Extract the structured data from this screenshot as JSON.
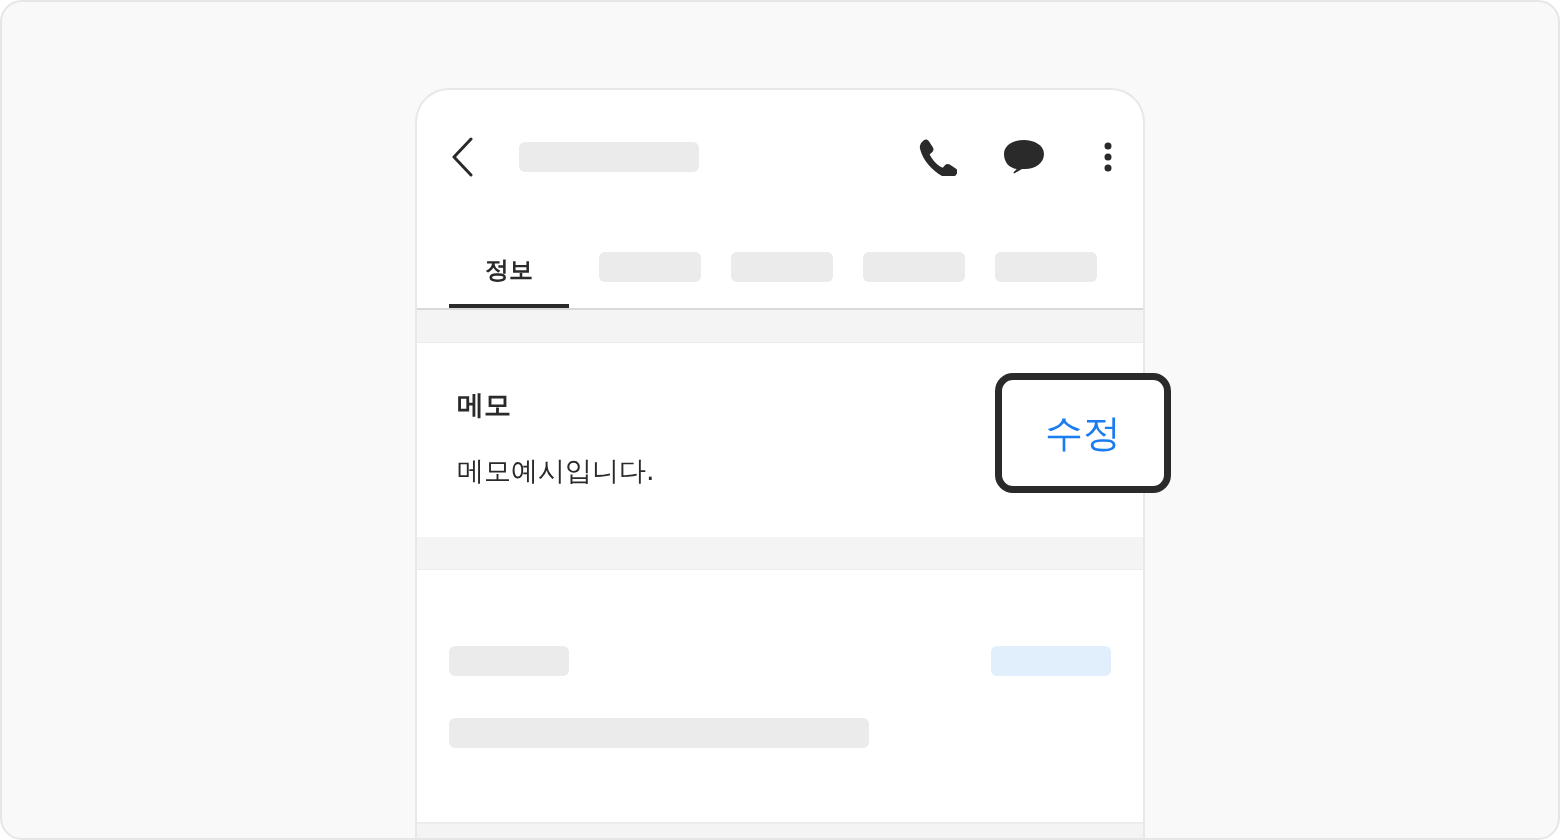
{
  "tabs": [
    {
      "label": "정보",
      "selected": true
    },
    {
      "selected": false
    },
    {
      "selected": false
    },
    {
      "selected": false
    },
    {
      "selected": false
    }
  ],
  "memo": {
    "title": "메모",
    "text": "메모예시입니다.",
    "edit_button": "수정"
  }
}
